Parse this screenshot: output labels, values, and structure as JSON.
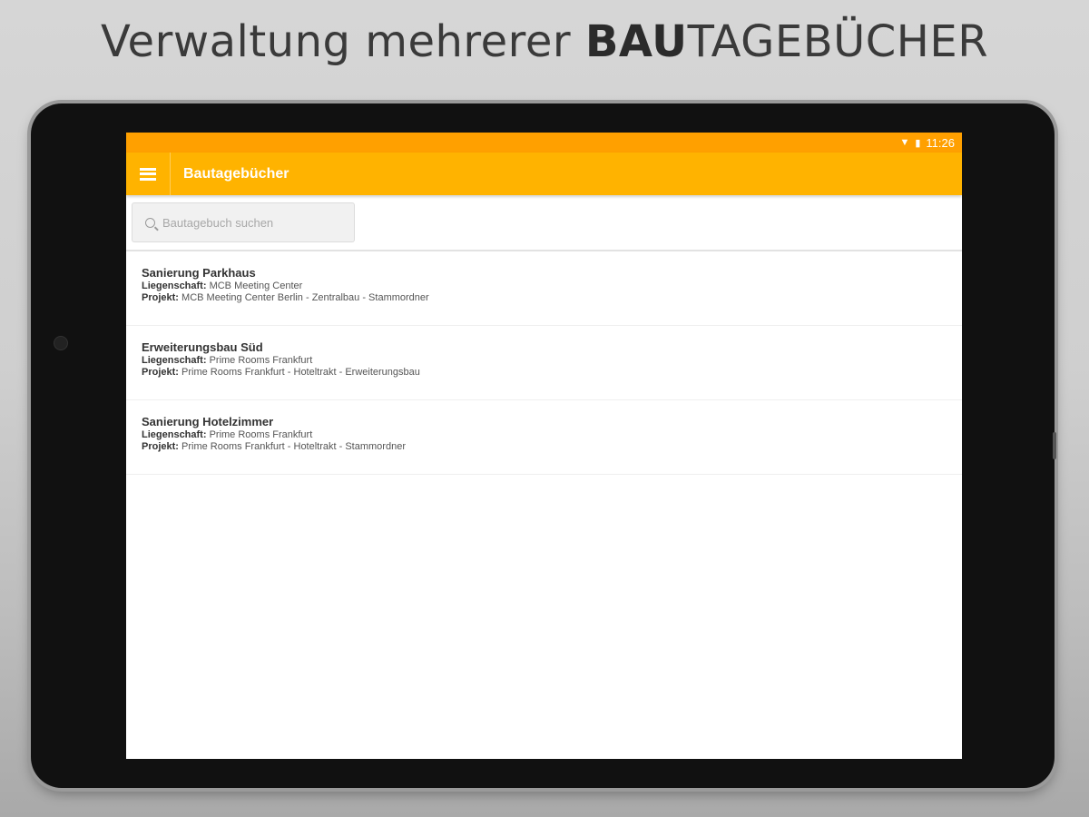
{
  "headline": {
    "normal": "Verwaltung mehrerer ",
    "bold": "BAU",
    "rest": "TAGEBÜCHER"
  },
  "statusbar": {
    "time": "11:26"
  },
  "appbar": {
    "title": "Bautagebücher"
  },
  "search": {
    "placeholder": "Bautagebuch suchen"
  },
  "labels": {
    "property": "Liegenschaft:",
    "project": "Projekt:"
  },
  "items": [
    {
      "title": "Sanierung Parkhaus",
      "property": "MCB Meeting Center",
      "project": "MCB Meeting Center Berlin - Zentralbau - Stammordner"
    },
    {
      "title": "Erweiterungsbau Süd",
      "property": "Prime Rooms Frankfurt",
      "project": "Prime Rooms Frankfurt - Hoteltrakt - Erweiterungsbau"
    },
    {
      "title": "Sanierung Hotelzimmer",
      "property": "Prime Rooms Frankfurt",
      "project": "Prime Rooms Frankfurt - Hoteltrakt - Stammordner"
    }
  ],
  "colors": {
    "statusbar": "#ffa000",
    "appbar": "#ffb300"
  }
}
